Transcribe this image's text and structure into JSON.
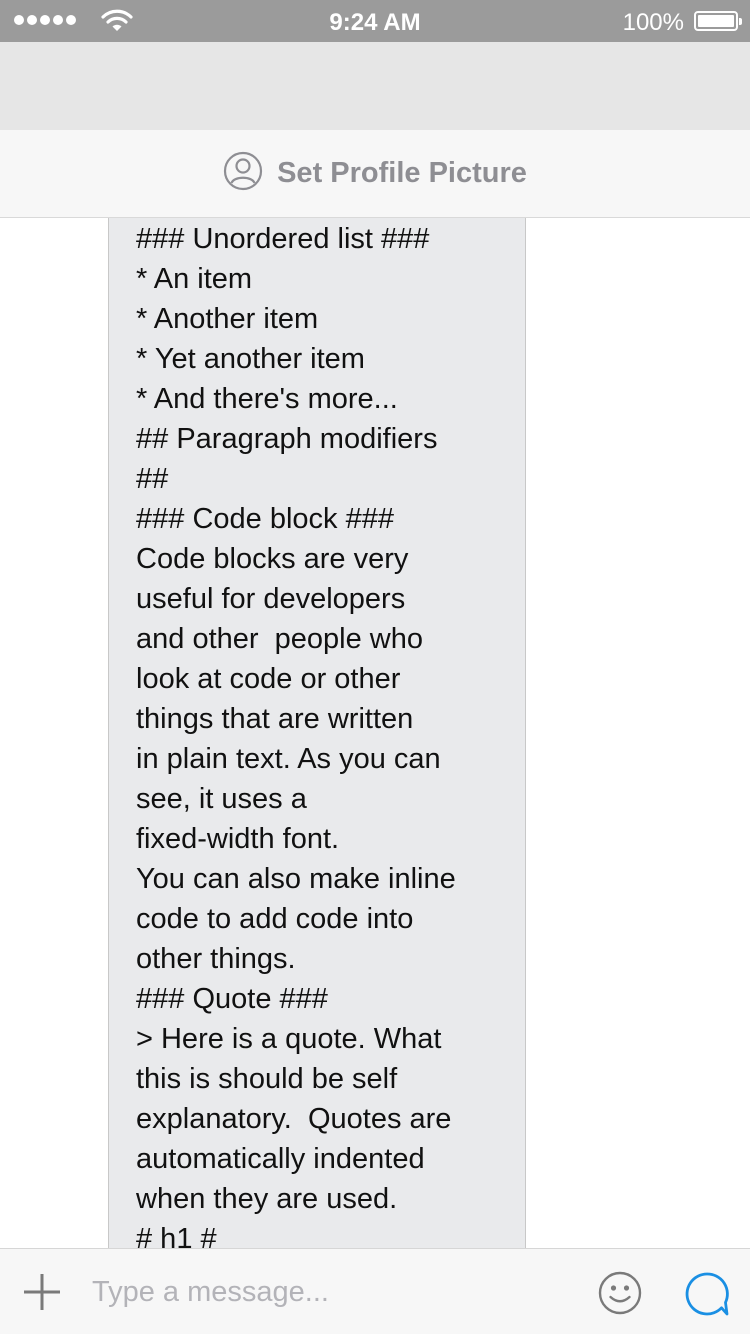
{
  "status_bar": {
    "signal_dots": 5,
    "time": "9:24 AM",
    "battery_percent": "100%",
    "battery_level": 1.0,
    "icons": [
      "signal-dots-icon",
      "wifi-icon",
      "battery-icon"
    ]
  },
  "header": {
    "profile_label": "Set Profile Picture",
    "profile_icon": "person-circle-icon"
  },
  "message": {
    "lines": [
      "### Unordered list ###",
      "* An item",
      "* Another item",
      "* Yet another item",
      "* And there's more...",
      "## Paragraph modifiers",
      "##",
      "### Code block ###",
      "Code blocks are very",
      "useful for developers",
      "and other  people who",
      "look at code or other",
      "things that are written",
      "in plain text. As you can",
      "see, it uses a",
      "fixed-width font.",
      "You can also make inline",
      "code to add code into",
      "other things.",
      "### Quote ###",
      "> Here is a quote. What",
      "this is should be self",
      "explanatory.  Quotes are",
      "automatically indented",
      "when they are used.",
      "# h1 #"
    ]
  },
  "composer": {
    "placeholder": "Type a message...",
    "value": "",
    "plus_icon": "plus-icon",
    "emoji_icon": "smiley-icon",
    "send_icon": "chat-bubble-icon",
    "accent_color": "#1a8fe3"
  }
}
